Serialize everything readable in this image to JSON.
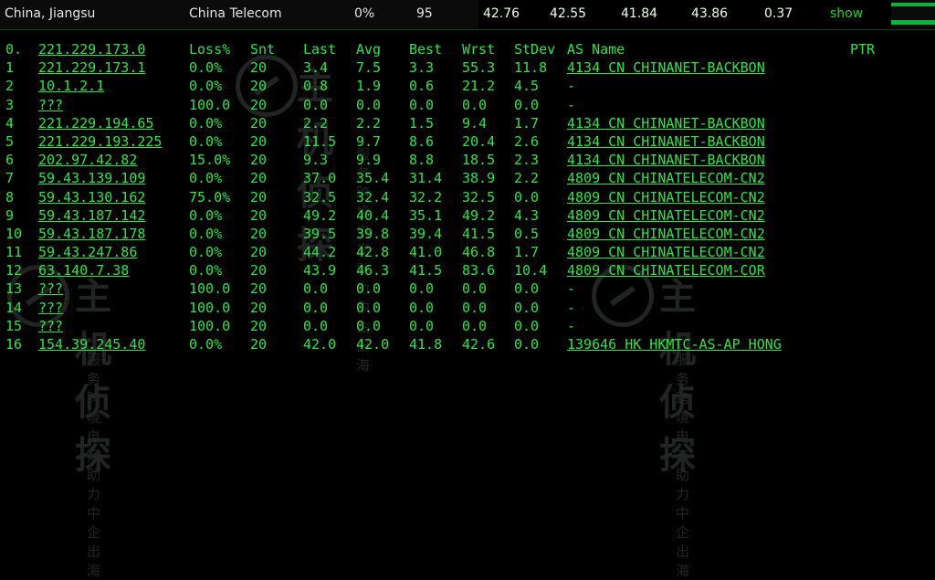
{
  "topbar": {
    "location": "China, Jiangsu",
    "isp": "China Telecom",
    "loss": "0%",
    "count": "95",
    "v1": "42.76",
    "v2": "42.55",
    "v3": "41.84",
    "v4": "43.86",
    "v5": "0.37",
    "show_label": "show"
  },
  "header": {
    "idx": "0.",
    "host": "221.229.173.0",
    "loss": "Loss%",
    "snt": "Snt",
    "last": "Last",
    "avg": "Avg",
    "best": "Best",
    "wrst": "Wrst",
    "stdev": "StDev",
    "as": "AS Name",
    "ptr": "PTR"
  },
  "hops": [
    {
      "idx": "1",
      "host": "221.229.173.1",
      "loss": "0.0%",
      "snt": "20",
      "last": "3.4",
      "avg": "7.5",
      "best": "3.3",
      "wrst": "55.3",
      "stdev": "11.8",
      "as": "4134  CN CHINANET-BACKBON"
    },
    {
      "idx": "2",
      "host": "10.1.2.1",
      "loss": "0.0%",
      "snt": "20",
      "last": "0.8",
      "avg": "1.9",
      "best": "0.6",
      "wrst": "21.2",
      "stdev": "4.5",
      "as": "-"
    },
    {
      "idx": "3",
      "host": "???",
      "loss": "100.0",
      "snt": "20",
      "last": "0.0",
      "avg": "0.0",
      "best": "0.0",
      "wrst": "0.0",
      "stdev": "0.0",
      "as": "-"
    },
    {
      "idx": "4",
      "host": "221.229.194.65",
      "loss": "0.0%",
      "snt": "20",
      "last": "2.2",
      "avg": "2.2",
      "best": "1.5",
      "wrst": "9.4",
      "stdev": "1.7",
      "as": "4134  CN CHINANET-BACKBON"
    },
    {
      "idx": "5",
      "host": "221.229.193.225",
      "loss": "0.0%",
      "snt": "20",
      "last": "11.5",
      "avg": "9.7",
      "best": "8.6",
      "wrst": "20.4",
      "stdev": "2.6",
      "as": "4134  CN CHINANET-BACKBON"
    },
    {
      "idx": "6",
      "host": "202.97.42.82",
      "loss": "15.0%",
      "snt": "20",
      "last": "9.3",
      "avg": "9.9",
      "best": "8.8",
      "wrst": "18.5",
      "stdev": "2.3",
      "as": "4134  CN CHINANET-BACKBON"
    },
    {
      "idx": "7",
      "host": "59.43.139.109",
      "loss": "0.0%",
      "snt": "20",
      "last": "37.0",
      "avg": "35.4",
      "best": "31.4",
      "wrst": "38.9",
      "stdev": "2.2",
      "as": "4809  CN CHINATELECOM-CN2"
    },
    {
      "idx": "8",
      "host": "59.43.130.162",
      "loss": "75.0%",
      "snt": "20",
      "last": "32.5",
      "avg": "32.4",
      "best": "32.2",
      "wrst": "32.5",
      "stdev": "0.0",
      "as": "4809  CN CHINATELECOM-CN2"
    },
    {
      "idx": "9",
      "host": "59.43.187.142",
      "loss": "0.0%",
      "snt": "20",
      "last": "49.2",
      "avg": "40.4",
      "best": "35.1",
      "wrst": "49.2",
      "stdev": "4.3",
      "as": "4809  CN CHINATELECOM-CN2"
    },
    {
      "idx": "10",
      "host": "59.43.187.178",
      "loss": "0.0%",
      "snt": "20",
      "last": "39.5",
      "avg": "39.8",
      "best": "39.4",
      "wrst": "41.5",
      "stdev": "0.5",
      "as": "4809  CN CHINATELECOM-CN2"
    },
    {
      "idx": "11",
      "host": "59.43.247.86",
      "loss": "0.0%",
      "snt": "20",
      "last": "44.2",
      "avg": "42.8",
      "best": "41.0",
      "wrst": "46.8",
      "stdev": "1.7",
      "as": "4809  CN CHINATELECOM-CN2"
    },
    {
      "idx": "12",
      "host": "63.140.7.38",
      "loss": "0.0%",
      "snt": "20",
      "last": "43.9",
      "avg": "46.3",
      "best": "41.5",
      "wrst": "83.6",
      "stdev": "10.4",
      "as": "4809  CN CHINATELECOM-COR"
    },
    {
      "idx": "13",
      "host": "???",
      "loss": "100.0",
      "snt": "20",
      "last": "0.0",
      "avg": "0.0",
      "best": "0.0",
      "wrst": "0.0",
      "stdev": "0.0",
      "as": "-"
    },
    {
      "idx": "14",
      "host": "???",
      "loss": "100.0",
      "snt": "20",
      "last": "0.0",
      "avg": "0.0",
      "best": "0.0",
      "wrst": "0.0",
      "stdev": "0.0",
      "as": "-"
    },
    {
      "idx": "15",
      "host": "???",
      "loss": "100.0",
      "snt": "20",
      "last": "0.0",
      "avg": "0.0",
      "best": "0.0",
      "wrst": "0.0",
      "stdev": "0.0",
      "as": "-"
    },
    {
      "idx": "16",
      "host": "154.39.245.40",
      "loss": "0.0%",
      "snt": "20",
      "last": "42.0",
      "avg": "42.0",
      "best": "41.8",
      "wrst": "42.6",
      "stdev": "0.0",
      "as": "139646 HK HKMTC-AS-AP HONG"
    }
  ],
  "watermark": {
    "main": "主机侦探",
    "sub": "服务跨境电商 助力中企出海"
  },
  "colors": {
    "terminal_green": "#36e04a",
    "show_green": "#1ad13a",
    "background": "#000000"
  }
}
